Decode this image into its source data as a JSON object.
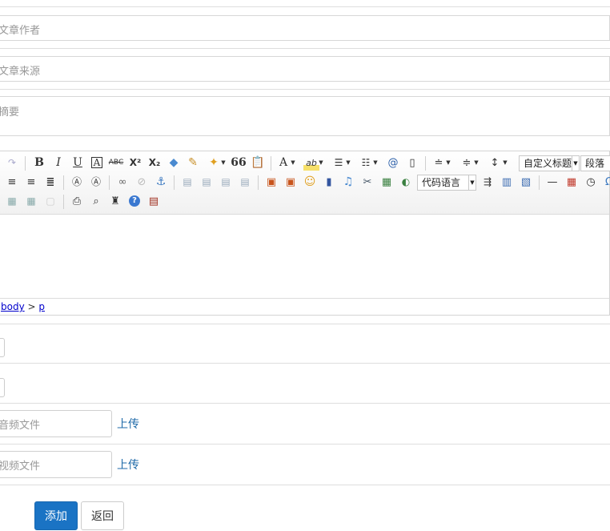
{
  "form": {
    "author_placeholder": "文章作者",
    "source_placeholder": "文章来源",
    "summary_placeholder": "摘要",
    "audio_placeholder": "音频文件",
    "video_placeholder": "视频文件",
    "upload_label_1": "上传",
    "upload_label_2": "上传",
    "submit_label": "添加",
    "back_label": "返回"
  },
  "editor": {
    "toolbar": {
      "heading_combo": "自定义标题",
      "paragraph_combo": "段落",
      "code_language_combo": "代码语言",
      "bold_label": "B",
      "italic_label": "I",
      "underline_label": "U",
      "font_color_label": "A",
      "strikethrough_label": "ABC",
      "superscript_label": "X²",
      "subscript_label": "X₂",
      "blockquote_label": "66"
    },
    "statusbar": {
      "path_body": "body",
      "path_sep": ">",
      "path_p": "p"
    }
  },
  "colors": {
    "primary": "#1a73c4",
    "link": "#1e6aa8",
    "placeholder": "#999999",
    "border": "#d7d7d7"
  }
}
